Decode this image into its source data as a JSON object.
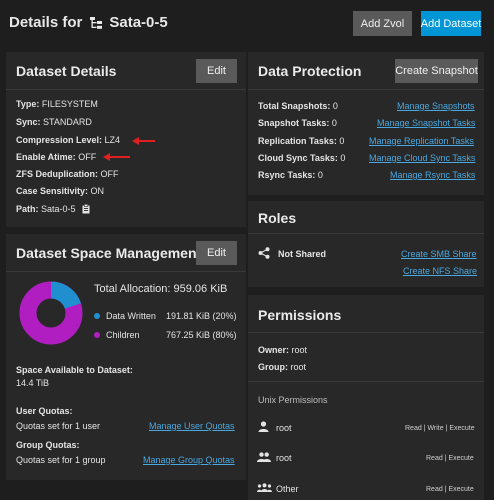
{
  "header": {
    "title_prefix": "Details for",
    "title_name": "Sata-0-5",
    "add_zvol_label": "Add Zvol",
    "add_dataset_label": "Add Dataset"
  },
  "dataset_details": {
    "title": "Dataset Details",
    "edit_label": "Edit",
    "rows": [
      {
        "key": "Type:",
        "value": "FILESYSTEM"
      },
      {
        "key": "Sync:",
        "value": "STANDARD"
      },
      {
        "key": "Compression Level:",
        "value": "LZ4"
      },
      {
        "key": "Enable Atime:",
        "value": "OFF"
      },
      {
        "key": "ZFS Deduplication:",
        "value": "OFF"
      },
      {
        "key": "Case Sensitivity:",
        "value": "ON"
      },
      {
        "key": "Path:",
        "value": "Sata-0-5"
      }
    ]
  },
  "space": {
    "title": "Dataset Space Management",
    "edit_label": "Edit",
    "total_label": "Total Allocation:",
    "total_value": "959.06 KiB",
    "legend": [
      {
        "label": "Data Written",
        "value": "191.81 KiB (20%)",
        "color": "#1f8fd0",
        "percent": 20
      },
      {
        "label": "Children",
        "value": "767.25 KiB (80%)",
        "color": "#b01dc0",
        "percent": 80
      }
    ],
    "available_label": "Space Available to Dataset:",
    "available_value": "14.4 TiB",
    "user_quotas_label": "User Quotas:",
    "user_quotas_value": "Quotas set for 1 user",
    "user_quotas_link": "Manage User Quotas",
    "group_quotas_label": "Group Quotas:",
    "group_quotas_value": "Quotas set for 1 group",
    "group_quotas_link": "Manage Group Quotas"
  },
  "protection": {
    "title": "Data Protection",
    "snapshot_button": "Create Snapshot",
    "rows": [
      {
        "key": "Total Snapshots:",
        "value": "0",
        "link": "Manage Snapshots"
      },
      {
        "key": "Snapshot Tasks:",
        "value": "0",
        "link": "Manage Snapshot Tasks"
      },
      {
        "key": "Replication Tasks:",
        "value": "0",
        "link": "Manage Replication Tasks"
      },
      {
        "key": "Cloud Sync Tasks:",
        "value": "0",
        "link": "Manage Cloud Sync Tasks"
      },
      {
        "key": "Rsync Tasks:",
        "value": "0",
        "link": "Manage Rsync Tasks"
      }
    ]
  },
  "roles": {
    "title": "Roles",
    "share_status": "Not Shared",
    "smb_link": "Create SMB Share",
    "nfs_link": "Create NFS Share"
  },
  "permissions": {
    "title": "Permissions",
    "owner_label": "Owner:",
    "owner_value": "root",
    "group_label": "Group:",
    "group_value": "root",
    "unix_label": "Unix Permissions",
    "entries": [
      {
        "name": "root",
        "perms": "Read | Write | Execute",
        "icon": "user-icon"
      },
      {
        "name": "root",
        "perms": "Read | Execute",
        "icon": "group-icon"
      },
      {
        "name": "Other",
        "perms": "Read | Execute",
        "icon": "others-icon"
      }
    ]
  },
  "colors": {
    "accent": "#0095d5",
    "link": "#4aa8e0",
    "annotation_arrow": "#e02020"
  }
}
